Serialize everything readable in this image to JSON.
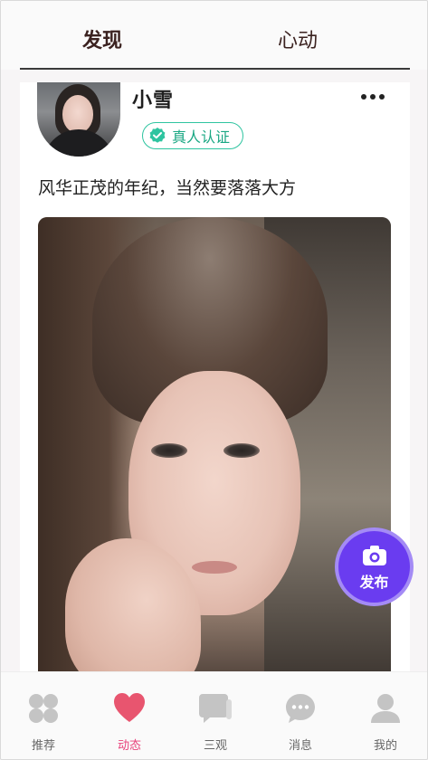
{
  "top_tabs": {
    "discover_label": "发现",
    "heart_label": "心动"
  },
  "post": {
    "username": "小雪",
    "verified_label": "真人认证",
    "text": "风华正茂的年纪，当然要落落大方",
    "verify_color": "#2ec4a0"
  },
  "publish": {
    "label": "发布",
    "color": "#6a3cf0"
  },
  "bottom_nav": {
    "items": [
      {
        "label": "推荐",
        "icon": "grid-icon"
      },
      {
        "label": "动态",
        "icon": "heart-icon",
        "active": true
      },
      {
        "label": "三观",
        "icon": "chat-square-icon"
      },
      {
        "label": "消息",
        "icon": "message-bubble-icon"
      },
      {
        "label": "我的",
        "icon": "person-icon"
      }
    ],
    "active_color": "#e8407a",
    "inactive_icon_color": "#c4c4c4"
  }
}
